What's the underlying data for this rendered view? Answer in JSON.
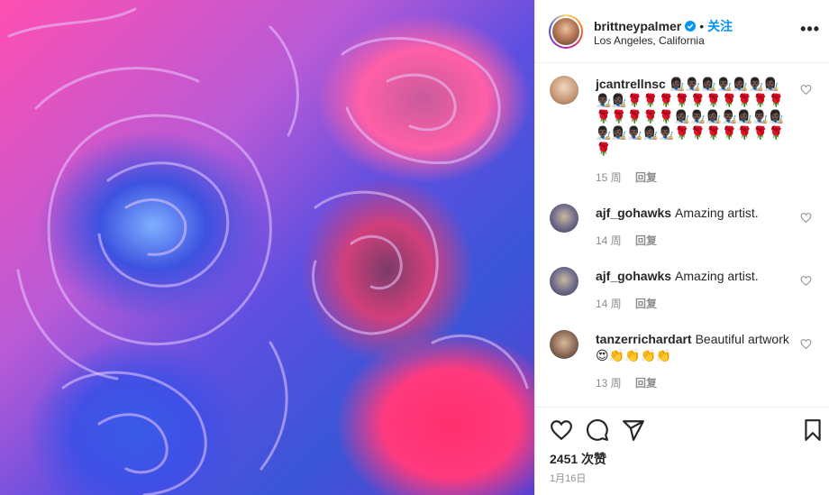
{
  "post": {
    "owner": "brittneypalmer",
    "follow_label": "关注",
    "dot": "•",
    "location": "Los Angeles, California",
    "more_label": "•••"
  },
  "comments": [
    {
      "username": "jcantrellnsc",
      "text": "👩🏿‍🎨👨🏿‍🎨👩🏿‍🎨👨🏿‍🎨👩🏿‍🎨👨🏿‍🎨👩🏿‍🎨👨🏿‍🎨👩🏿‍🎨🌹🌹🌹🌹🌹🌹🌹🌹🌹🌹🌹🌹🌹🌹🌹👩🏿‍🎨👨🏿‍🎨👩🏿‍🎨👨🏿‍🎨👩🏿‍🎨👨🏿‍🎨👩🏿‍🎨👨🏿‍🎨👩🏿‍🎨👨🏿‍🎨👩🏿‍🎨👨🏿‍🎨🌹🌹🌹🌹🌹🌹🌹🌹",
      "age": "15 周",
      "reply": "回复"
    },
    {
      "username": "ajf_gohawks",
      "text": "Amazing artist.",
      "age": "14 周",
      "reply": "回复"
    },
    {
      "username": "ajf_gohawks",
      "text": "Amazing artist.",
      "age": "14 周",
      "reply": "回复"
    },
    {
      "username": "tanzerrichardart",
      "text": "Beautiful artwork 😍👏👏👏👏",
      "age": "13 周",
      "reply": "回复"
    }
  ],
  "footer": {
    "likes": "2451 次赞",
    "date": "1月16日"
  },
  "icons": [
    "verified-badge-icon",
    "heart-icon",
    "comment-icon",
    "share-icon",
    "bookmark-icon"
  ],
  "colors": {
    "accent": "#0095f6",
    "muted": "#8e8e8e"
  }
}
